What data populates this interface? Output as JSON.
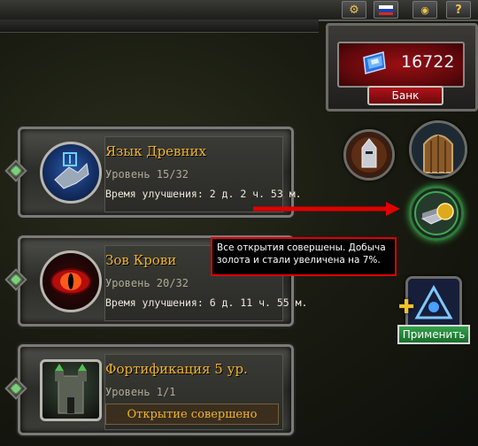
{
  "topbar": {
    "settings_icon": "gear-icon",
    "language_icon": "russian-flag-icon",
    "feed_icon": "rss-icon",
    "help_label": "?"
  },
  "currency": {
    "icon": "blue-gem-icon",
    "value": "16722",
    "bank_label": "Банк"
  },
  "skills": [
    {
      "title": "Язык Древних",
      "level": "Уровень 15/32",
      "time": "Время улучшения: 2 д. 2 ч. 53 м.",
      "icon": "rune-glove-icon"
    },
    {
      "title": "Зов Крови",
      "level": "Уровень 20/32",
      "time": "Время улучшения: 6 д. 11 ч. 55 м.",
      "icon": "red-eye-icon"
    },
    {
      "title": "Фортификация 5 ур.",
      "level": "Уровень 1/1",
      "status": "Открытие совершено",
      "icon": "fortress-tower-icon"
    }
  ],
  "tooltip": {
    "text": "Все открытия совершены. Добыча золота и стали увеличена на 7%."
  },
  "right_panel": {
    "icons": [
      "knight-helmet-icon",
      "wooden-door-icon",
      "steel-gold-icon",
      "rune-triangle-icon"
    ],
    "apply_label": "Применить"
  },
  "colors": {
    "accent_gold": "#f0b42a",
    "danger_red": "#e00000",
    "apply_green": "#33a24a"
  }
}
